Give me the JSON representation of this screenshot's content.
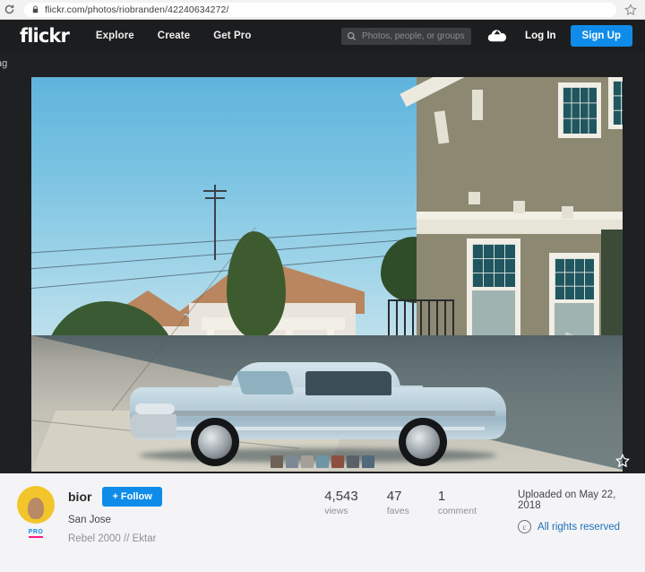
{
  "browser": {
    "url": "flickr.com/photos/riobranden/42240634272/",
    "reload_icon": "reload-icon",
    "lock_icon": "lock-icon",
    "bookmark_icon": "bookmark-star-icon"
  },
  "nav": {
    "logo": "flickr",
    "links": [
      {
        "label": "Explore"
      },
      {
        "label": "Create"
      },
      {
        "label": "Get Pro"
      }
    ],
    "search": {
      "placeholder": "Photos, people, or groups",
      "value": "",
      "icon": "search-icon"
    },
    "upload_icon": "cloud-upload-icon",
    "login_label": "Log In",
    "signup_label": "Sign Up",
    "background_color": "#1c1d1f",
    "accent_color": "#0f8ce9"
  },
  "stage": {
    "tag_label": "tag",
    "background_color": "#1f2022",
    "favorite_icon": "star-outline-icon",
    "thumbnails": [
      {
        "color": "#6e6158"
      },
      {
        "color": "#7d8894"
      },
      {
        "color": "#a5a097"
      },
      {
        "color": "#6d95a8"
      },
      {
        "color": "#8a4f3e"
      },
      {
        "color": "#5b6068"
      },
      {
        "color": "#51697a"
      }
    ]
  },
  "photo": {
    "alt": "Light blue 1963 Chevrolet Impala parked on a concrete driveway beside a craftsman house",
    "sky_color": "#79c2e2",
    "car_color": "#b6ccd9",
    "house_color": "#8d8872"
  },
  "owner": {
    "name": "bior",
    "follow_label": "+ Follow",
    "location": "San Jose",
    "caption": "Rebel 2000 // Ektar",
    "pro_badge": "PRO",
    "avatar_name": "avatar"
  },
  "stats": [
    {
      "value": "4,543",
      "label": "views"
    },
    {
      "value": "47",
      "label": "faves"
    },
    {
      "value": "1",
      "label": "comment"
    }
  ],
  "meta": {
    "upload_date": "Uploaded on May 22, 2018",
    "license": "All rights reserved",
    "license_icon": "copyright-icon"
  }
}
